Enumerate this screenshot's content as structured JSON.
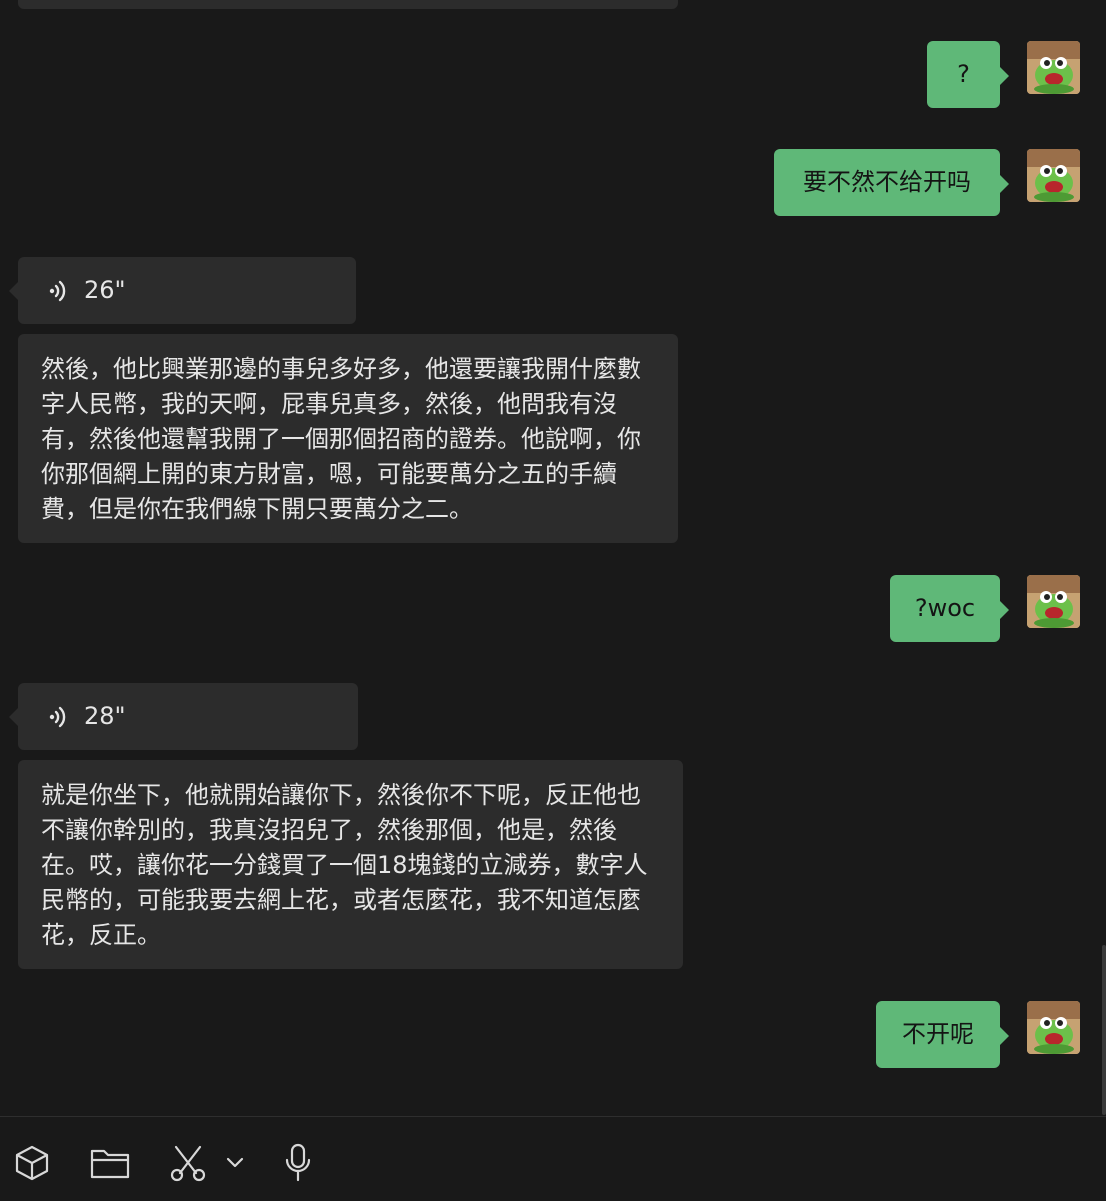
{
  "messages": [
    {
      "id": "m1",
      "side": "out",
      "type": "text",
      "text": "?"
    },
    {
      "id": "m2",
      "side": "out",
      "type": "text",
      "text": "要不然不给开吗"
    },
    {
      "id": "m3",
      "side": "in",
      "type": "voice",
      "duration": "26\""
    },
    {
      "id": "m4",
      "side": "in",
      "type": "transcript",
      "text": "然後，他比興業那邊的事兒多好多，他還要讓我開什麼數字人民幣，我的天啊，屁事兒真多，然後，他問我有沒有，然後他還幫我開了一個那個招商的證券。他說啊，你你那個網上開的東方財富，嗯，可能要萬分之五的手續費，但是你在我們線下開只要萬分之二。"
    },
    {
      "id": "m5",
      "side": "out",
      "type": "text",
      "text": "?woc"
    },
    {
      "id": "m6",
      "side": "in",
      "type": "voice",
      "duration": "28\""
    },
    {
      "id": "m7",
      "side": "in",
      "type": "transcript",
      "text": "就是你坐下，他就開始讓你下，然後你不下呢，反正他也不讓你幹別的，我真沒招兒了，然後那個，他是，然後在。哎，讓你花一分錢買了一個18塊錢的立減券，數字人民幣的，可能我要去網上花，或者怎麼花，我不知道怎麼花，反正。"
    },
    {
      "id": "m8",
      "side": "out",
      "type": "text",
      "text": "不开呢"
    }
  ],
  "toolbar": {
    "items": [
      "cube-icon",
      "folder-icon",
      "scissors-icon",
      "chevron-down-icon",
      "microphone-icon"
    ]
  },
  "colors": {
    "background": "#191919",
    "incoming_bubble": "#2c2c2c",
    "outgoing_bubble": "#5fb878"
  }
}
